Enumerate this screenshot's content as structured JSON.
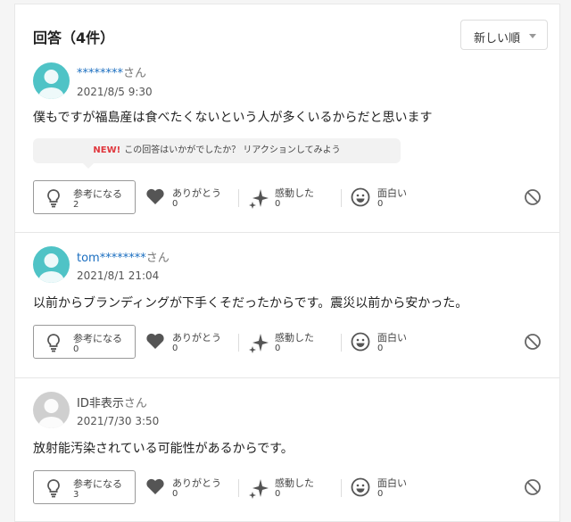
{
  "header": {
    "title": "回答（4件）",
    "sort_label": "新しい順"
  },
  "prompt": {
    "new_badge": "NEW!",
    "text": "この回答はいかがでしたか？ リアクションしてみよう"
  },
  "answers": [
    {
      "name": "********",
      "suffix": "さん",
      "date": "2021/8/5 9:30",
      "text": "僕もですが福島産は食べたくないという人が多くいるからだと思います",
      "reactions": {
        "helpful": {
          "label": "参考になる",
          "count": "2"
        },
        "thanks": {
          "label": "ありがとう",
          "count": "0"
        },
        "moved": {
          "label": "感動した",
          "count": "0"
        },
        "funny": {
          "label": "面白い",
          "count": "0"
        }
      }
    },
    {
      "name": "tom********",
      "suffix": "さん",
      "date": "2021/8/1 21:04",
      "text": "以前からブランディングが下手くそだったからです。震災以前から安かった。",
      "reactions": {
        "helpful": {
          "label": "参考になる",
          "count": "0"
        },
        "thanks": {
          "label": "ありがとう",
          "count": "0"
        },
        "moved": {
          "label": "感動した",
          "count": "0"
        },
        "funny": {
          "label": "面白い",
          "count": "0"
        }
      }
    },
    {
      "name": "ID非表示",
      "suffix": "さん",
      "date": "2021/7/30 3:50",
      "text": "放射能汚染されている可能性があるからです。",
      "reactions": {
        "helpful": {
          "label": "参考になる",
          "count": "3"
        },
        "thanks": {
          "label": "ありがとう",
          "count": "0"
        },
        "moved": {
          "label": "感動した",
          "count": "0"
        },
        "funny": {
          "label": "面白い",
          "count": "0"
        }
      }
    }
  ],
  "colors": {
    "avatar_teal": "#4fc3c6",
    "avatar_gray": "#cfcfcf",
    "link_blue": "#1a6ec0",
    "new_red": "#e0383e"
  }
}
